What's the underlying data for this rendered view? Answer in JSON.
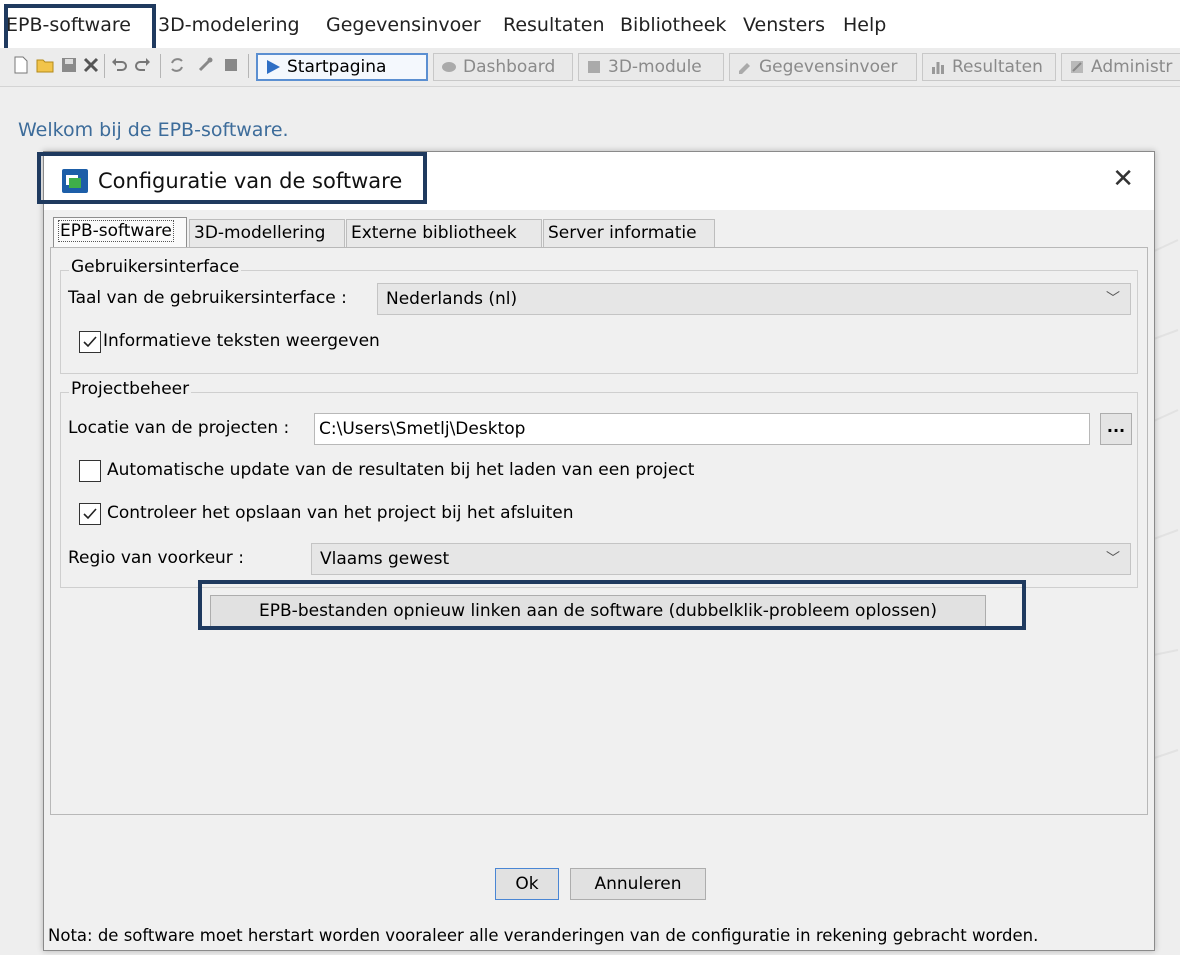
{
  "menubar": {
    "items": [
      "EPB-software",
      "3D-modelering",
      "Gegevensinvoer",
      "Resultaten",
      "Bibliotheek",
      "Vensters",
      "Help"
    ]
  },
  "toolbar": {
    "buttons": [
      {
        "label": "Startpagina",
        "icon": "play-icon",
        "active": true
      },
      {
        "label": "Dashboard",
        "icon": "eye-icon",
        "active": false
      },
      {
        "label": "3D-module",
        "icon": "cube-icon",
        "active": false
      },
      {
        "label": "Gegevensinvoer",
        "icon": "pencil-icon",
        "active": false
      },
      {
        "label": "Resultaten",
        "icon": "bar-chart-icon",
        "active": false
      },
      {
        "label": "Administr",
        "icon": "admin-icon",
        "active": false
      }
    ]
  },
  "main": {
    "welcome": "Welkom bij de EPB-software."
  },
  "dialog": {
    "title": "Configuratie van de software",
    "close_icon": "close-icon",
    "tabs": [
      "EPB-software",
      "3D-modellering",
      "Externe bibliotheek",
      "Server informatie"
    ],
    "gebruikersinterface": {
      "legend": "Gebruikersinterface",
      "language_label": "Taal van de gebruikersinterface :",
      "language_value": "Nederlands (nl)",
      "info_texts_label": "Informatieve teksten weergeven",
      "info_texts_checked": true
    },
    "projectbeheer": {
      "legend": "Projectbeheer",
      "location_label": "Locatie van de projecten :",
      "location_value": "C:\\Users\\Smetlj\\Desktop",
      "browse_label": "...",
      "auto_update_label": "Automatische update van de resultaten bij het laden van een project",
      "auto_update_checked": false,
      "check_save_label": "Controleer het opslaan van het project bij het afsluiten",
      "check_save_checked": true,
      "region_label": "Regio van voorkeur :",
      "region_value": "Vlaams gewest"
    },
    "relink_button": "EPB-bestanden opnieuw linken aan de software (dubbelklik-probleem oplossen)",
    "ok_button": "Ok",
    "cancel_button": "Annuleren",
    "nota": "Nota: de software moet herstart worden vooraleer alle veranderingen van de configuratie in rekening gebracht worden."
  },
  "colors": {
    "highlight_box": "#1f3a5f",
    "welcome_text": "#3d6c9a",
    "active_tab_border": "#5b8fd1"
  }
}
